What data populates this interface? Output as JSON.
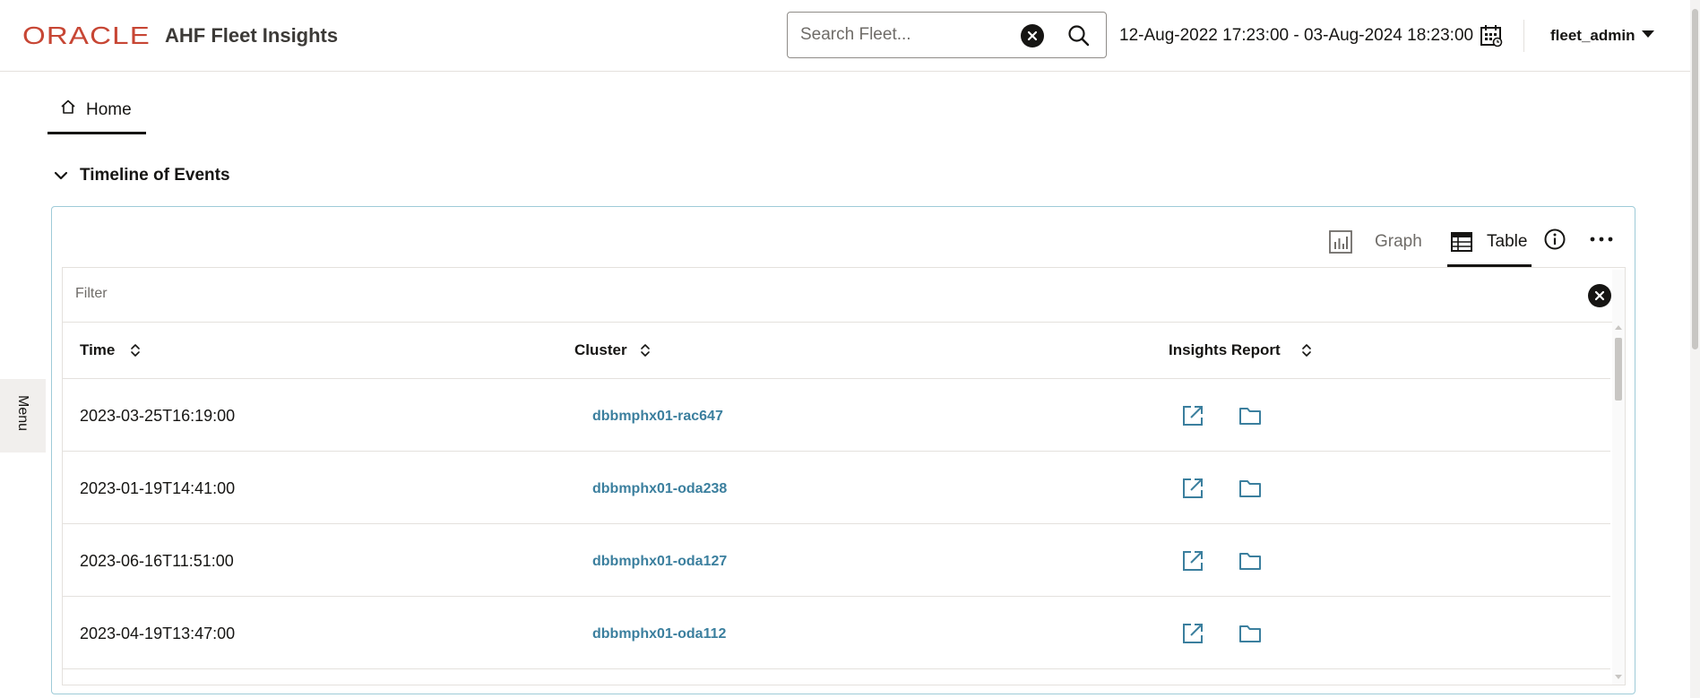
{
  "header": {
    "brand": "ORACLE",
    "app_title": "AHF Fleet Insights",
    "search_placeholder": "Search Fleet...",
    "date_range": "12-Aug-2022 17:23:00 - 03-Aug-2024 18:23:00",
    "user": "fleet_admin"
  },
  "nav": {
    "home_label": "Home"
  },
  "section": {
    "title": "Timeline of Events"
  },
  "view_tabs": {
    "graph_label": "Graph",
    "table_label": "Table",
    "selected": "Table"
  },
  "table": {
    "filter_placeholder": "Filter",
    "columns": [
      "Time",
      "Cluster",
      "Insights Report"
    ],
    "rows": [
      {
        "time": "2023-03-25T16:19:00",
        "cluster": "dbbmphx01-rac647"
      },
      {
        "time": "2023-01-19T14:41:00",
        "cluster": "dbbmphx01-oda238"
      },
      {
        "time": "2023-06-16T11:51:00",
        "cluster": "dbbmphx01-oda127"
      },
      {
        "time": "2023-04-19T13:47:00",
        "cluster": "dbbmphx01-oda112"
      }
    ]
  },
  "side_menu": {
    "label": "Menu"
  },
  "colors": {
    "brand": "#c74634",
    "link": "#3b7f9e",
    "card_border": "#9ecbd8"
  }
}
